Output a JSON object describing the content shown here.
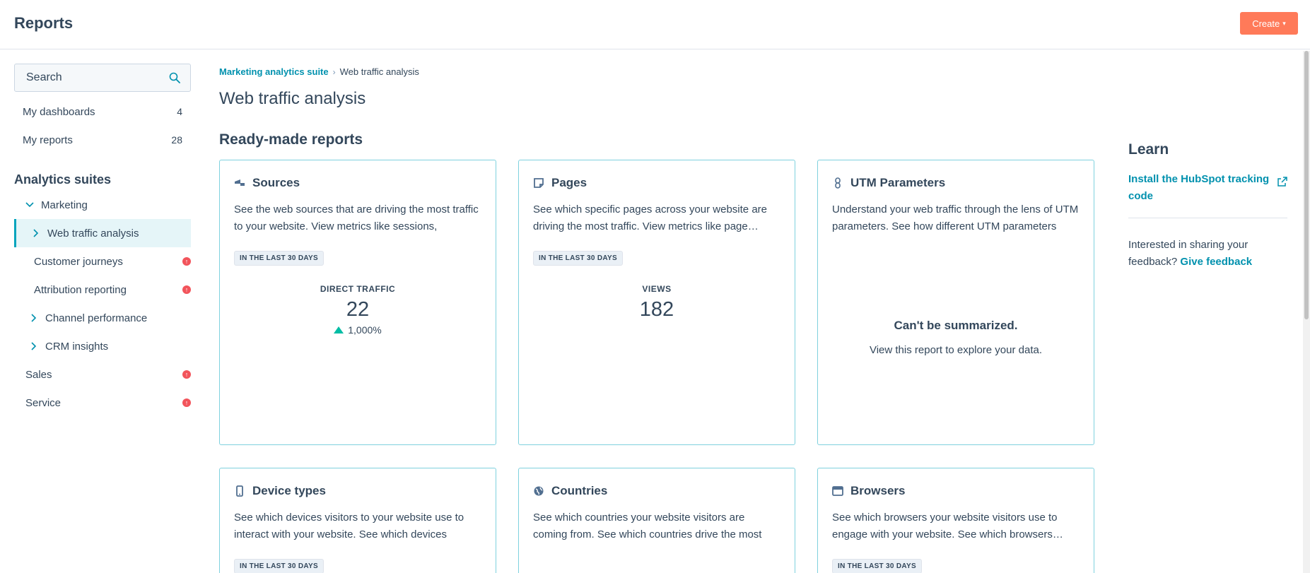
{
  "header": {
    "title": "Reports",
    "create_label": "Create"
  },
  "sidebar": {
    "search_placeholder": "Search",
    "top_items": [
      {
        "label": "My dashboards",
        "count": "4"
      },
      {
        "label": "My reports",
        "count": "28"
      }
    ],
    "suites_title": "Analytics suites",
    "marketing_label": "Marketing",
    "marketing_children": [
      {
        "label": "Web traffic analysis"
      },
      {
        "label": "Customer journeys"
      },
      {
        "label": "Attribution reporting"
      },
      {
        "label": "Channel performance"
      },
      {
        "label": "CRM insights"
      }
    ],
    "sales_label": "Sales",
    "service_label": "Service"
  },
  "breadcrumb": {
    "parent": "Marketing analytics suite",
    "current": "Web traffic analysis"
  },
  "main": {
    "title": "Web traffic analysis",
    "section_heading": "Ready-made reports",
    "cards": [
      {
        "title": "Sources",
        "icon": "sources-icon",
        "desc": "See the web sources that are driving the most traffic to your website. View metrics like sessions, session…",
        "badge": "IN THE LAST 30 DAYS",
        "metric_label": "DIRECT TRAFFIC",
        "metric_value": "22",
        "metric_change": "1,000%"
      },
      {
        "title": "Pages",
        "icon": "pages-icon",
        "desc": "See which specific pages across your website are driving the most traffic. View metrics like page…",
        "badge": "IN THE LAST 30 DAYS",
        "metric_label": "VIEWS",
        "metric_value": "182"
      },
      {
        "title": "UTM Parameters",
        "icon": "link-icon",
        "desc": "Understand your web traffic through the lens of UTM parameters. See how different UTM parameters are…",
        "nosum_title": "Can't be summarized.",
        "nosum_sub": "View this report to explore your data."
      },
      {
        "title": "Device types",
        "icon": "device-icon",
        "desc": "See which devices visitors to your website use to interact with your website. See which devices drive…",
        "badge": "IN THE LAST 30 DAYS"
      },
      {
        "title": "Countries",
        "icon": "globe-icon",
        "desc": "See which countries your website visitors are coming from. See which countries drive the most page…"
      },
      {
        "title": "Browsers",
        "icon": "browser-icon",
        "desc": "See which browsers your website visitors use to engage with your website. See which browsers…",
        "badge": "IN THE LAST 30 DAYS"
      }
    ]
  },
  "learn": {
    "title": "Learn",
    "link_label": "Install the HubSpot tracking code",
    "feedback_text": "Interested in sharing your feedback?",
    "feedback_link": "Give feedback"
  },
  "colors": {
    "accent": "#0091ae",
    "create": "#ff7a59",
    "warning": "#f2545b",
    "card_border": "#7fd1de",
    "positive": "#00bda5"
  }
}
